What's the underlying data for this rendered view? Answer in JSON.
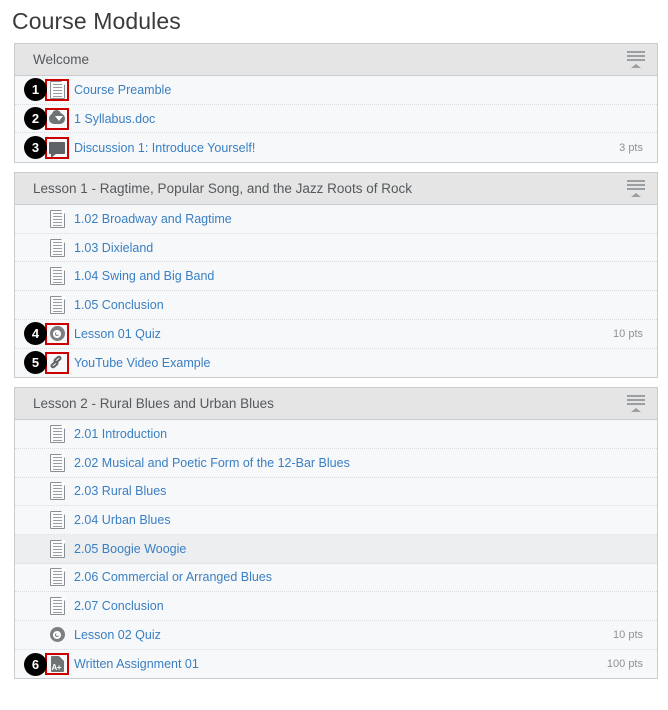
{
  "page": {
    "title": "Course Modules"
  },
  "icons": {
    "menu": "hamburger-collapse-icon",
    "document": "document-icon",
    "download": "download-cloud-icon",
    "discussion": "discussion-bubble-icon",
    "quiz": "quiz-rocket-icon",
    "link": "external-link-icon",
    "assignment": "assignment-a-plus-icon"
  },
  "colors": {
    "link": "#3a7fc3",
    "header_bg": "#e5e5e5",
    "row_bg": "#f7f8f9",
    "row_hover_bg": "#eceef0",
    "border": "#c7cdd1",
    "points_text": "#8d9297",
    "callout_bg": "#000000",
    "highlight_box": "#cc0000"
  },
  "modules": [
    {
      "title": "Welcome",
      "items": [
        {
          "label": "Course Preamble",
          "icon": "document",
          "points": "",
          "callout": "1",
          "highlighted": true,
          "hovered": false
        },
        {
          "label": "1 Syllabus.doc",
          "icon": "download",
          "points": "",
          "callout": "2",
          "highlighted": true,
          "hovered": false
        },
        {
          "label": "Discussion 1: Introduce Yourself!",
          "icon": "discussion",
          "points": "3 pts",
          "callout": "3",
          "highlighted": true,
          "hovered": false
        }
      ]
    },
    {
      "title": "Lesson 1 - Ragtime, Popular Song, and the Jazz Roots of Rock",
      "items": [
        {
          "label": "1.02 Broadway and Ragtime",
          "icon": "document",
          "points": "",
          "callout": "",
          "highlighted": false,
          "hovered": false
        },
        {
          "label": "1.03 Dixieland",
          "icon": "document",
          "points": "",
          "callout": "",
          "highlighted": false,
          "hovered": false
        },
        {
          "label": "1.04 Swing and Big Band",
          "icon": "document",
          "points": "",
          "callout": "",
          "highlighted": false,
          "hovered": false
        },
        {
          "label": "1.05 Conclusion",
          "icon": "document",
          "points": "",
          "callout": "",
          "highlighted": false,
          "hovered": false
        },
        {
          "label": "Lesson 01 Quiz",
          "icon": "quiz",
          "points": "10 pts",
          "callout": "4",
          "highlighted": true,
          "hovered": false
        },
        {
          "label": "YouTube Video Example",
          "icon": "link",
          "points": "",
          "callout": "5",
          "highlighted": true,
          "hovered": false
        }
      ]
    },
    {
      "title": "Lesson 2 - Rural Blues and Urban Blues",
      "items": [
        {
          "label": "2.01 Introduction",
          "icon": "document",
          "points": "",
          "callout": "",
          "highlighted": false,
          "hovered": false
        },
        {
          "label": "2.02 Musical and Poetic Form of the 12-Bar Blues",
          "icon": "document",
          "points": "",
          "callout": "",
          "highlighted": false,
          "hovered": false
        },
        {
          "label": "2.03 Rural Blues",
          "icon": "document",
          "points": "",
          "callout": "",
          "highlighted": false,
          "hovered": false
        },
        {
          "label": "2.04 Urban Blues",
          "icon": "document",
          "points": "",
          "callout": "",
          "highlighted": false,
          "hovered": false
        },
        {
          "label": "2.05 Boogie Woogie",
          "icon": "document",
          "points": "",
          "callout": "",
          "highlighted": false,
          "hovered": true
        },
        {
          "label": "2.06 Commercial or Arranged Blues",
          "icon": "document",
          "points": "",
          "callout": "",
          "highlighted": false,
          "hovered": false
        },
        {
          "label": "2.07 Conclusion",
          "icon": "document",
          "points": "",
          "callout": "",
          "highlighted": false,
          "hovered": false
        },
        {
          "label": "Lesson 02 Quiz",
          "icon": "quiz",
          "points": "10 pts",
          "callout": "",
          "highlighted": false,
          "hovered": false
        },
        {
          "label": "Written Assignment 01",
          "icon": "assignment",
          "points": "100 pts",
          "callout": "6",
          "highlighted": true,
          "hovered": false
        }
      ]
    }
  ]
}
